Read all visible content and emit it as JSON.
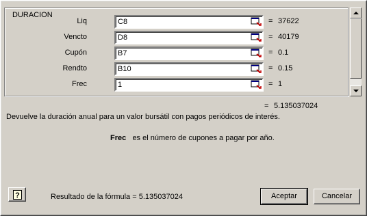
{
  "dialog": {
    "function_name": "DURACION",
    "arguments": [
      {
        "label": "Liq",
        "input": "C8",
        "value": "37622"
      },
      {
        "label": "Vencto",
        "input": "D8",
        "value": "40179"
      },
      {
        "label": "Cupón",
        "input": "B7",
        "value": "0.1"
      },
      {
        "label": "Rendto",
        "input": "B10",
        "value": "0.15"
      },
      {
        "label": "Frec",
        "input": "1",
        "value": "1"
      }
    ],
    "equals_sign": "=",
    "result_value": "5.135037024",
    "description": "Devuelve la duración anual para  un valor bursátil con pagos periódicos de interés.",
    "arg_help_name": "Frec",
    "arg_help_text": "es el número de cupones a pagar por año.",
    "formula_result_label": "Resultado de la fórmula =",
    "formula_result_value": "5.135037024",
    "ok_label": "Aceptar",
    "cancel_label": "Cancelar"
  },
  "icons": {
    "collapse": "collapse-dialog-icon",
    "help": "help-question-icon",
    "scroll_up": "arrow-up-icon",
    "scroll_down": "arrow-down-icon"
  }
}
